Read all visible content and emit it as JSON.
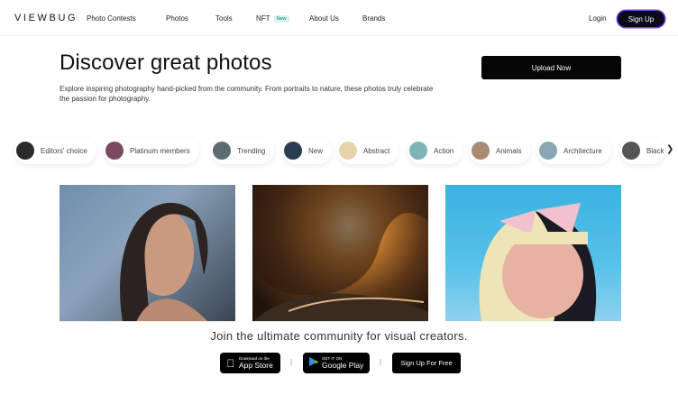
{
  "nav": {
    "logo": "VIEWBUG",
    "links": [
      "Photo Contests",
      "Photos",
      "Tools",
      "NFT",
      "About Us",
      "Brands"
    ],
    "nft_badge": "New",
    "login": "Login",
    "signup": "Sign Up"
  },
  "hero": {
    "title": "Discover great photos",
    "description": "Explore inspiring photography hand-picked from the community. From portraits to nature, these photos truly celebrate the passion for photography.",
    "upload_button": "Upload Now"
  },
  "categories": [
    {
      "label": "Editors' choice",
      "color": "#2a2a2a"
    },
    {
      "label": "Platinum members",
      "color": "#7a4a5e"
    },
    {
      "label": "Trending",
      "color": "#5d6a70"
    },
    {
      "label": "New",
      "color": "#2b3d52"
    },
    {
      "label": "Abstract",
      "color": "#e8d2ae"
    },
    {
      "label": "Action",
      "color": "#7fb3b6"
    },
    {
      "label": "Animals",
      "color": "#a88c70"
    },
    {
      "label": "Architecture",
      "color": "#8aa6b4"
    },
    {
      "label": "Black",
      "color": "#555555"
    }
  ],
  "photos": [
    "portrait-woman",
    "cave",
    "blonde-bow-woman"
  ],
  "promo": {
    "headline": "Join the ultimate community for visual creators.",
    "appstore_small": "Download on the",
    "appstore_big": "App Store",
    "gplay_small": "GET IT ON",
    "gplay_big": "Google Play",
    "signup_free": "Sign Up For Free"
  },
  "colors": {
    "accent": "#7a3cf0",
    "button": "#050505"
  }
}
